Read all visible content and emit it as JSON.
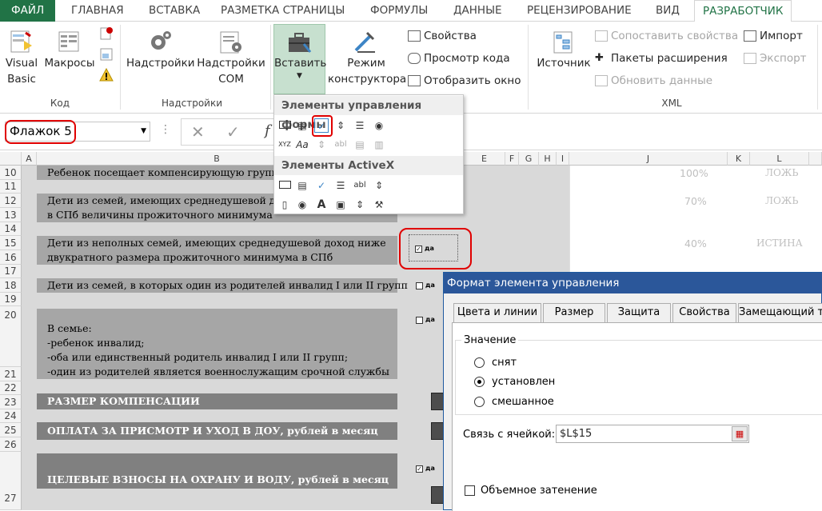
{
  "tabs": {
    "file": "ФАЙЛ",
    "home": "ГЛАВНАЯ",
    "insert": "ВСТАВКА",
    "layout": "РАЗМЕТКА СТРАНИЦЫ",
    "formulas": "ФОРМУЛЫ",
    "data": "ДАННЫЕ",
    "review": "РЕЦЕНЗИРОВАНИЕ",
    "view": "ВИД",
    "developer": "РАЗРАБОТЧИК"
  },
  "ribbon": {
    "code": {
      "vb1": "Visual",
      "vb2": "Basic",
      "macros": "Макросы",
      "label": "Код"
    },
    "addins": {
      "addins": "Надстройки",
      "com1": "Надстройки",
      "com2": "COM",
      "label": "Надстройки"
    },
    "controls": {
      "insert": "Вставить",
      "design1": "Режим",
      "design2": "конструктора",
      "properties": "Свойства",
      "view_code": "Просмотр кода",
      "show_window": "Отобразить окно"
    },
    "xml": {
      "source": "Источник",
      "map_props": "Сопоставить свойства",
      "packs": "Пакеты расширения",
      "refresh": "Обновить данные",
      "import": "Импорт",
      "export": "Экспорт",
      "label": "XML"
    }
  },
  "formula_bar": {
    "name_box": "Флажок 5",
    "fx": "f"
  },
  "columns": [
    "A",
    "B",
    "E",
    "F",
    "G",
    "H",
    "I",
    "J",
    "K",
    "L"
  ],
  "rows": [
    "10",
    "11",
    "12",
    "13",
    "14",
    "15",
    "16",
    "17",
    "18",
    "19",
    "20",
    "21",
    "22",
    "23",
    "24",
    "25",
    "26",
    "27"
  ],
  "cells": {
    "r10": "Ребенок посещает компенсирующую группу",
    "r12a": "Дети из семей, имеющих среднедушевой дох",
    "r12b": "в СПб величины прожиточного минимума",
    "r15a": "Дети из неполных семей, имеющих среднедушевой доход ниже",
    "r15b": "двукратного размера прожиточного минимума в СПб",
    "r18": "Дети из семей, в которых один из родителей инвалид I или II групп",
    "r21a": "В семье:",
    "r21b": "-ребенок инвалид;",
    "r21c": "-оба или единственный родитель инвалид I или II групп;",
    "r21d": "-один из родителей является военнослужащим срочной службы",
    "r23": "РАЗМЕР КОМПЕНСАЦИИ",
    "r25": "ОПЛАТА ЗА ПРИСМОТР И УХОД В ДОУ, рублей в месяц",
    "r27": "ЦЕЛЕВЫЕ ВЗНОСЫ НА ОХРАНУ И ВОДУ, рублей в месяц",
    "j10": "100%",
    "l10": "ЛОЖЬ",
    "j12": "70%",
    "l12": "ЛОЖЬ",
    "j15": "40%",
    "l15": "ИСТИНА"
  },
  "checkbox_label": "да",
  "dropdown": {
    "form_header": "Элементы управления формы",
    "activex_header": "Элементы ActiveX"
  },
  "dialog": {
    "title": "Формат элемента управления",
    "tabs": [
      "Цвета и линии",
      "Размер",
      "Защита",
      "Свойства",
      "Замещающий т"
    ],
    "value_group": "Значение",
    "opt_unchecked": "снят",
    "opt_checked": "установлен",
    "opt_mixed": "смешанное",
    "link_label": "Связь с ячейкой:",
    "link_value": "$L$15",
    "shading": "Объемное затенение"
  },
  "colors": {
    "accent": "#217346",
    "dialog_title": "#2b579a",
    "highlight": "#e00000",
    "band": "#a6a6a6",
    "band_dark": "#808080"
  }
}
